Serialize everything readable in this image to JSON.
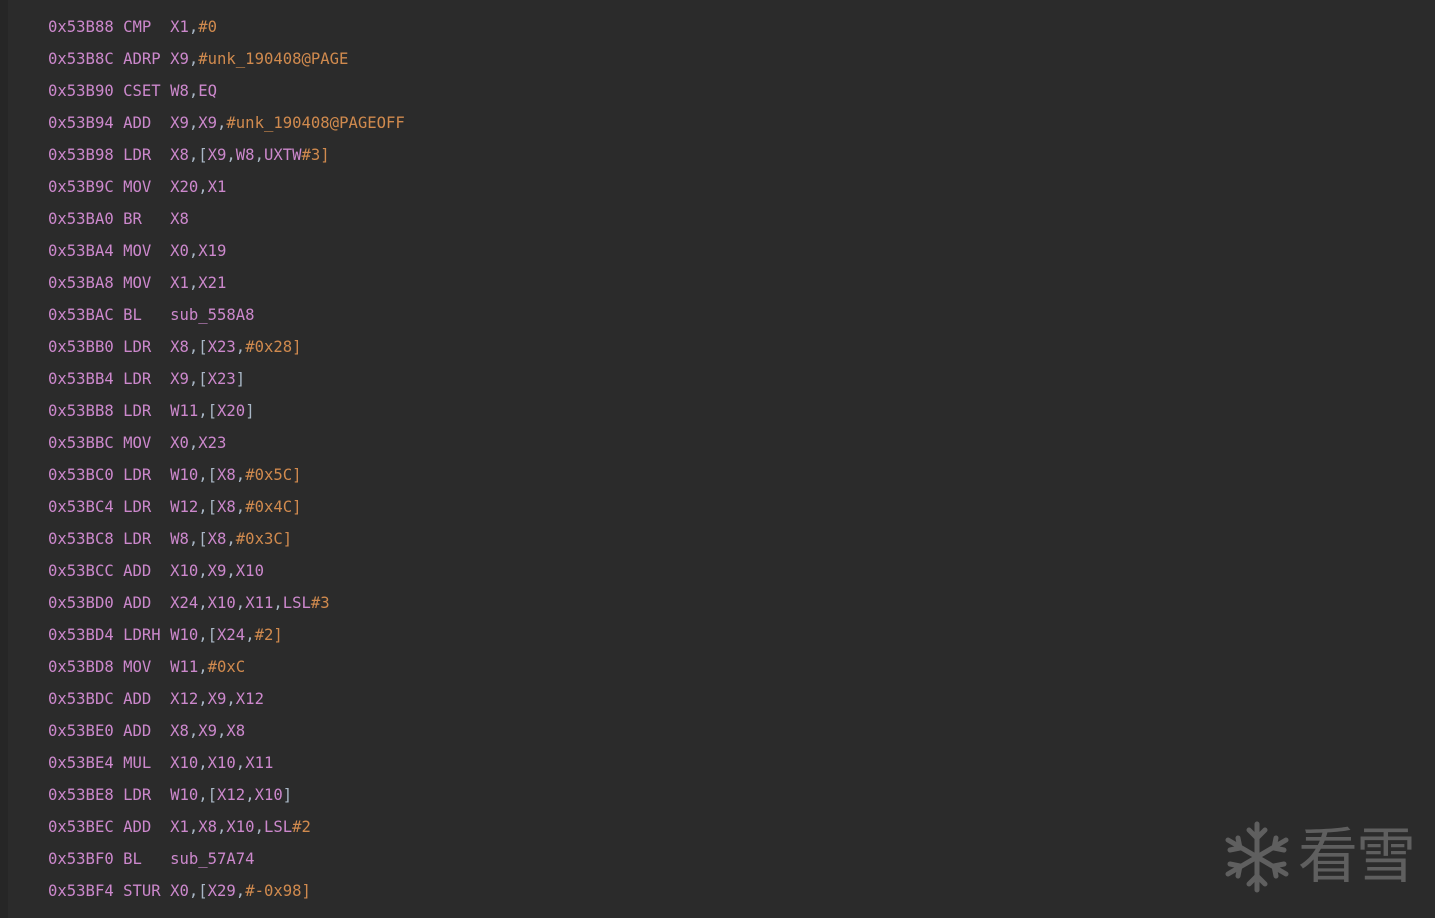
{
  "colors": {
    "background": "#2b2b2b",
    "mnemonic": "#cc88cc",
    "immediate": "#d08a4e",
    "punct": "#a9b7c6",
    "watermark": "#8a8a8a"
  },
  "lines": [
    {
      "addr": "0x53B88",
      "mn": "CMP ",
      "ops": [
        [
          "reg",
          "X1"
        ],
        [
          "sep",
          ","
        ],
        [
          "imm",
          "#0"
        ]
      ]
    },
    {
      "addr": "0x53B8C",
      "mn": "ADRP",
      "ops": [
        [
          "reg",
          "X9"
        ],
        [
          "sep",
          ","
        ],
        [
          "imm",
          "#unk_190408@PAGE"
        ]
      ]
    },
    {
      "addr": "0x53B90",
      "mn": "CSET",
      "ops": [
        [
          "reg",
          "W8"
        ],
        [
          "sep",
          ","
        ],
        [
          "reg",
          "EQ"
        ]
      ]
    },
    {
      "addr": "0x53B94",
      "mn": "ADD ",
      "ops": [
        [
          "reg",
          "X9"
        ],
        [
          "sep",
          ","
        ],
        [
          "reg",
          "X9"
        ],
        [
          "sep",
          ","
        ],
        [
          "imm",
          "#unk_190408@PAGEOFF"
        ]
      ]
    },
    {
      "addr": "0x53B98",
      "mn": "LDR ",
      "ops": [
        [
          "reg",
          "X8"
        ],
        [
          "sep",
          ",["
        ],
        [
          "reg",
          "X9"
        ],
        [
          "sep",
          ","
        ],
        [
          "reg",
          "W8"
        ],
        [
          "sep",
          ","
        ],
        [
          "reg",
          "UXTW"
        ],
        [
          "imm",
          "#3]"
        ]
      ]
    },
    {
      "addr": "0x53B9C",
      "mn": "MOV ",
      "ops": [
        [
          "reg",
          "X20"
        ],
        [
          "sep",
          ","
        ],
        [
          "reg",
          "X1"
        ]
      ]
    },
    {
      "addr": "0x53BA0",
      "mn": "BR  ",
      "ops": [
        [
          "reg",
          "X8"
        ]
      ]
    },
    {
      "addr": "0x53BA4",
      "mn": "MOV ",
      "ops": [
        [
          "reg",
          "X0"
        ],
        [
          "sep",
          ","
        ],
        [
          "reg",
          "X19"
        ]
      ]
    },
    {
      "addr": "0x53BA8",
      "mn": "MOV ",
      "ops": [
        [
          "reg",
          "X1"
        ],
        [
          "sep",
          ","
        ],
        [
          "reg",
          "X21"
        ]
      ]
    },
    {
      "addr": "0x53BAC",
      "mn": "BL  ",
      "ops": [
        [
          "reg",
          "sub_558A8"
        ]
      ]
    },
    {
      "addr": "0x53BB0",
      "mn": "LDR ",
      "ops": [
        [
          "reg",
          "X8"
        ],
        [
          "sep",
          ",["
        ],
        [
          "reg",
          "X23"
        ],
        [
          "sep",
          ","
        ],
        [
          "imm",
          "#0x28]"
        ]
      ]
    },
    {
      "addr": "0x53BB4",
      "mn": "LDR ",
      "ops": [
        [
          "reg",
          "X9"
        ],
        [
          "sep",
          ",["
        ],
        [
          "reg",
          "X23"
        ],
        [
          "sep",
          "]"
        ]
      ]
    },
    {
      "addr": "0x53BB8",
      "mn": "LDR ",
      "ops": [
        [
          "reg",
          "W11"
        ],
        [
          "sep",
          ",["
        ],
        [
          "reg",
          "X20"
        ],
        [
          "sep",
          "]"
        ]
      ]
    },
    {
      "addr": "0x53BBC",
      "mn": "MOV ",
      "ops": [
        [
          "reg",
          "X0"
        ],
        [
          "sep",
          ","
        ],
        [
          "reg",
          "X23"
        ]
      ]
    },
    {
      "addr": "0x53BC0",
      "mn": "LDR ",
      "ops": [
        [
          "reg",
          "W10"
        ],
        [
          "sep",
          ",["
        ],
        [
          "reg",
          "X8"
        ],
        [
          "sep",
          ","
        ],
        [
          "imm",
          "#0x5C]"
        ]
      ]
    },
    {
      "addr": "0x53BC4",
      "mn": "LDR ",
      "ops": [
        [
          "reg",
          "W12"
        ],
        [
          "sep",
          ",["
        ],
        [
          "reg",
          "X8"
        ],
        [
          "sep",
          ","
        ],
        [
          "imm",
          "#0x4C]"
        ]
      ]
    },
    {
      "addr": "0x53BC8",
      "mn": "LDR ",
      "ops": [
        [
          "reg",
          "W8"
        ],
        [
          "sep",
          ",["
        ],
        [
          "reg",
          "X8"
        ],
        [
          "sep",
          ","
        ],
        [
          "imm",
          "#0x3C]"
        ]
      ]
    },
    {
      "addr": "0x53BCC",
      "mn": "ADD ",
      "ops": [
        [
          "reg",
          "X10"
        ],
        [
          "sep",
          ","
        ],
        [
          "reg",
          "X9"
        ],
        [
          "sep",
          ","
        ],
        [
          "reg",
          "X10"
        ]
      ]
    },
    {
      "addr": "0x53BD0",
      "mn": "ADD ",
      "ops": [
        [
          "reg",
          "X24"
        ],
        [
          "sep",
          ","
        ],
        [
          "reg",
          "X10"
        ],
        [
          "sep",
          ","
        ],
        [
          "reg",
          "X11"
        ],
        [
          "sep",
          ","
        ],
        [
          "reg",
          "LSL"
        ],
        [
          "imm",
          "#3"
        ]
      ]
    },
    {
      "addr": "0x53BD4",
      "mn": "LDRH",
      "ops": [
        [
          "reg",
          "W10"
        ],
        [
          "sep",
          ",["
        ],
        [
          "reg",
          "X24"
        ],
        [
          "sep",
          ","
        ],
        [
          "imm",
          "#2]"
        ]
      ]
    },
    {
      "addr": "0x53BD8",
      "mn": "MOV ",
      "ops": [
        [
          "reg",
          "W11"
        ],
        [
          "sep",
          ","
        ],
        [
          "imm",
          "#0xC"
        ]
      ]
    },
    {
      "addr": "0x53BDC",
      "mn": "ADD ",
      "ops": [
        [
          "reg",
          "X12"
        ],
        [
          "sep",
          ","
        ],
        [
          "reg",
          "X9"
        ],
        [
          "sep",
          ","
        ],
        [
          "reg",
          "X12"
        ]
      ]
    },
    {
      "addr": "0x53BE0",
      "mn": "ADD ",
      "ops": [
        [
          "reg",
          "X8"
        ],
        [
          "sep",
          ","
        ],
        [
          "reg",
          "X9"
        ],
        [
          "sep",
          ","
        ],
        [
          "reg",
          "X8"
        ]
      ]
    },
    {
      "addr": "0x53BE4",
      "mn": "MUL ",
      "ops": [
        [
          "reg",
          "X10"
        ],
        [
          "sep",
          ","
        ],
        [
          "reg",
          "X10"
        ],
        [
          "sep",
          ","
        ],
        [
          "reg",
          "X11"
        ]
      ]
    },
    {
      "addr": "0x53BE8",
      "mn": "LDR ",
      "ops": [
        [
          "reg",
          "W10"
        ],
        [
          "sep",
          ",["
        ],
        [
          "reg",
          "X12"
        ],
        [
          "sep",
          ","
        ],
        [
          "reg",
          "X10"
        ],
        [
          "sep",
          "]"
        ]
      ]
    },
    {
      "addr": "0x53BEC",
      "mn": "ADD ",
      "ops": [
        [
          "reg",
          "X1"
        ],
        [
          "sep",
          ","
        ],
        [
          "reg",
          "X8"
        ],
        [
          "sep",
          ","
        ],
        [
          "reg",
          "X10"
        ],
        [
          "sep",
          ","
        ],
        [
          "reg",
          "LSL"
        ],
        [
          "imm",
          "#2"
        ]
      ]
    },
    {
      "addr": "0x53BF0",
      "mn": "BL  ",
      "ops": [
        [
          "reg",
          "sub_57A74"
        ]
      ]
    },
    {
      "addr": "0x53BF4",
      "mn": "STUR",
      "ops": [
        [
          "reg",
          "X0"
        ],
        [
          "sep",
          ",["
        ],
        [
          "reg",
          "X29"
        ],
        [
          "sep",
          ","
        ],
        [
          "imm",
          "#-0x98]"
        ]
      ]
    }
  ],
  "watermark": {
    "icon": "snowflake-icon",
    "text": "看雪"
  }
}
